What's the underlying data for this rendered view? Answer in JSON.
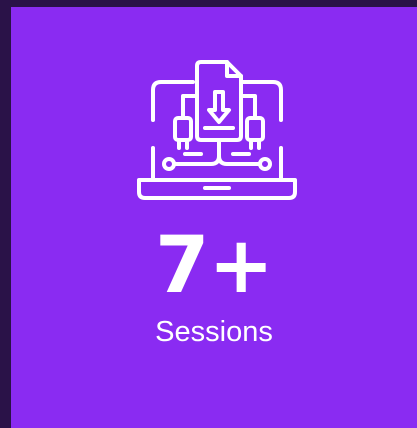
{
  "stat": {
    "icon": "laptop-download-icon",
    "value": "7+",
    "label": "Sessions"
  },
  "colors": {
    "card_background": "#8a2bf2",
    "page_background": "#2a1248",
    "text": "#ffffff"
  }
}
